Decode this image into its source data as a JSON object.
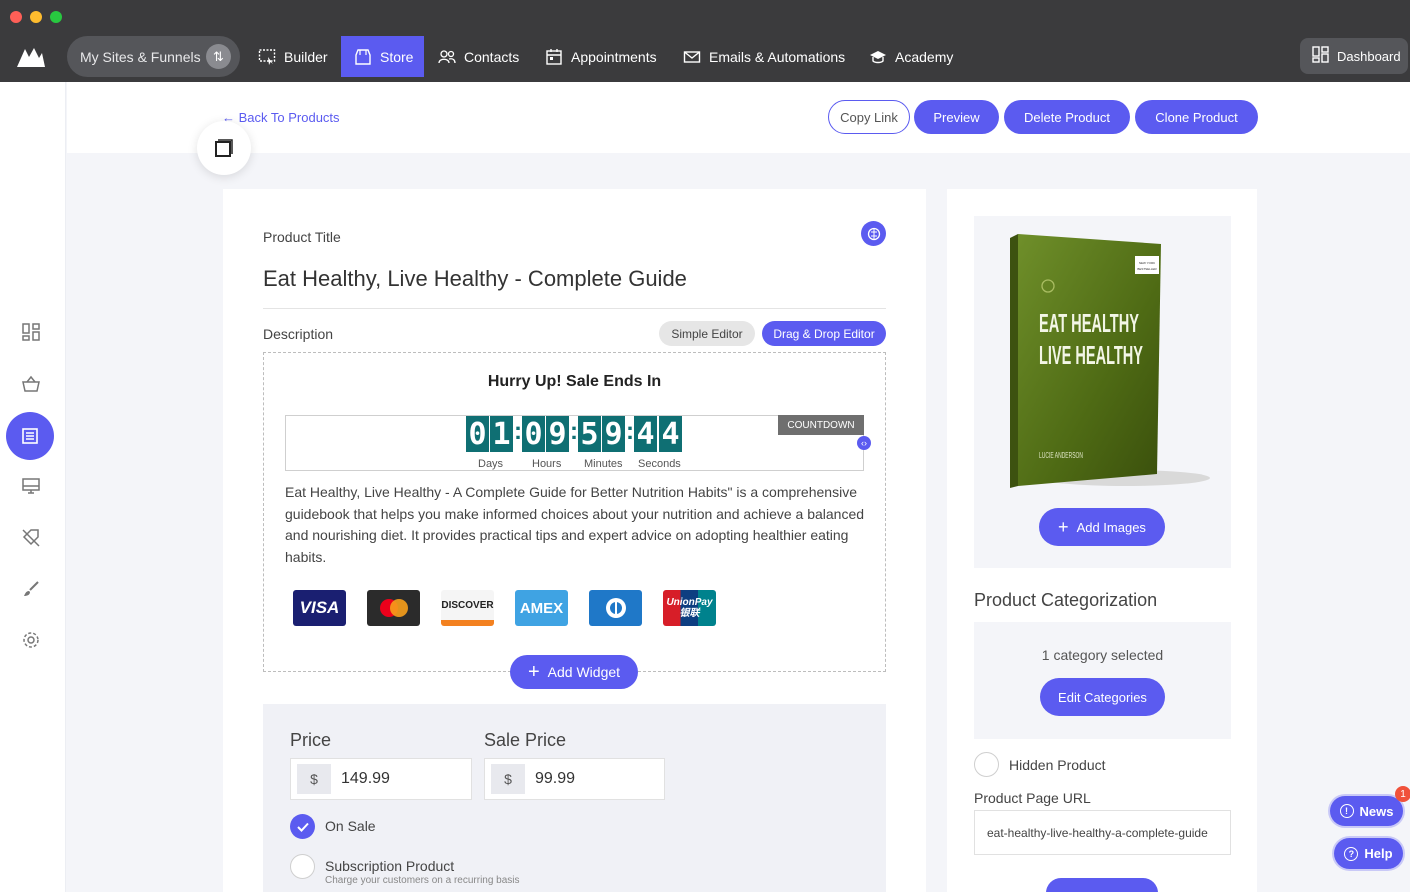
{
  "nav": {
    "sites_label": "My Sites & Funnels",
    "items": [
      {
        "label": "Builder",
        "icon": "builder-icon"
      },
      {
        "label": "Store",
        "icon": "store-icon"
      },
      {
        "label": "Contacts",
        "icon": "contacts-icon"
      },
      {
        "label": "Appointments",
        "icon": "calendar-icon"
      },
      {
        "label": "Emails & Automations",
        "icon": "mail-icon"
      },
      {
        "label": "Academy",
        "icon": "academy-icon"
      }
    ],
    "dashboard_label": "Dashboard"
  },
  "header": {
    "back_label": "← Back To Products",
    "copy_link": "Copy Link",
    "preview": "Preview",
    "delete": "Delete Product",
    "clone": "Clone Product"
  },
  "product": {
    "title_label": "Product Title",
    "title": "Eat Healthy, Live Healthy - Complete Guide",
    "description_label": "Description",
    "simple_editor": "Simple Editor",
    "dnd_editor": "Drag & Drop Editor",
    "countdown_heading": "Hurry Up! Sale Ends In",
    "countdown_tag": "COUNTDOWN",
    "countdown_digits": [
      "0",
      "1",
      "0",
      "9",
      "5",
      "9",
      "4",
      "4"
    ],
    "countdown_units": [
      "Days",
      "Hours",
      "Minutes",
      "Seconds"
    ],
    "description_text": "Eat Healthy, Live Healthy - A Complete Guide for Better Nutrition Habits\" is a comprehensive guidebook that helps you make informed choices about your nutrition and achieve a balanced and nourishing diet. It provides practical tips and expert advice on adopting healthier eating habits.",
    "payment_cards": [
      "VISA",
      "mastercard",
      "DISCOVER",
      "AMEX",
      "diners",
      "UnionPay 银联"
    ],
    "add_widget": "Add Widget",
    "price_label": "Price",
    "sale_price_label": "Sale Price",
    "currency": "$",
    "price": "149.99",
    "sale_price": "99.99",
    "on_sale_label": "On Sale",
    "subscription_label": "Subscription Product",
    "subscription_hint": "Charge your customers on a recurring basis"
  },
  "sidebar_panel": {
    "book": {
      "title_line1": "EAT HEALTHY",
      "title_line2": "LIVE HEALTHY",
      "author": "LUCIE ANDERSON",
      "badge_line1": "NEW YORK",
      "badge_line2": "BESTSELLER"
    },
    "add_images": "Add Images",
    "categorization_title": "Product Categorization",
    "category_count": "1 category selected",
    "edit_categories": "Edit Categories",
    "hidden_label": "Hidden Product",
    "url_label": "Product Page URL",
    "url_value": "eat-healthy-live-healthy-a-complete-guide"
  },
  "widgets": {
    "news": "News",
    "news_badge": "1",
    "help": "Help"
  },
  "colors": {
    "accent": "#5b5bf0",
    "topbar": "#3b3b3d",
    "countdown": "#0f6f73"
  }
}
